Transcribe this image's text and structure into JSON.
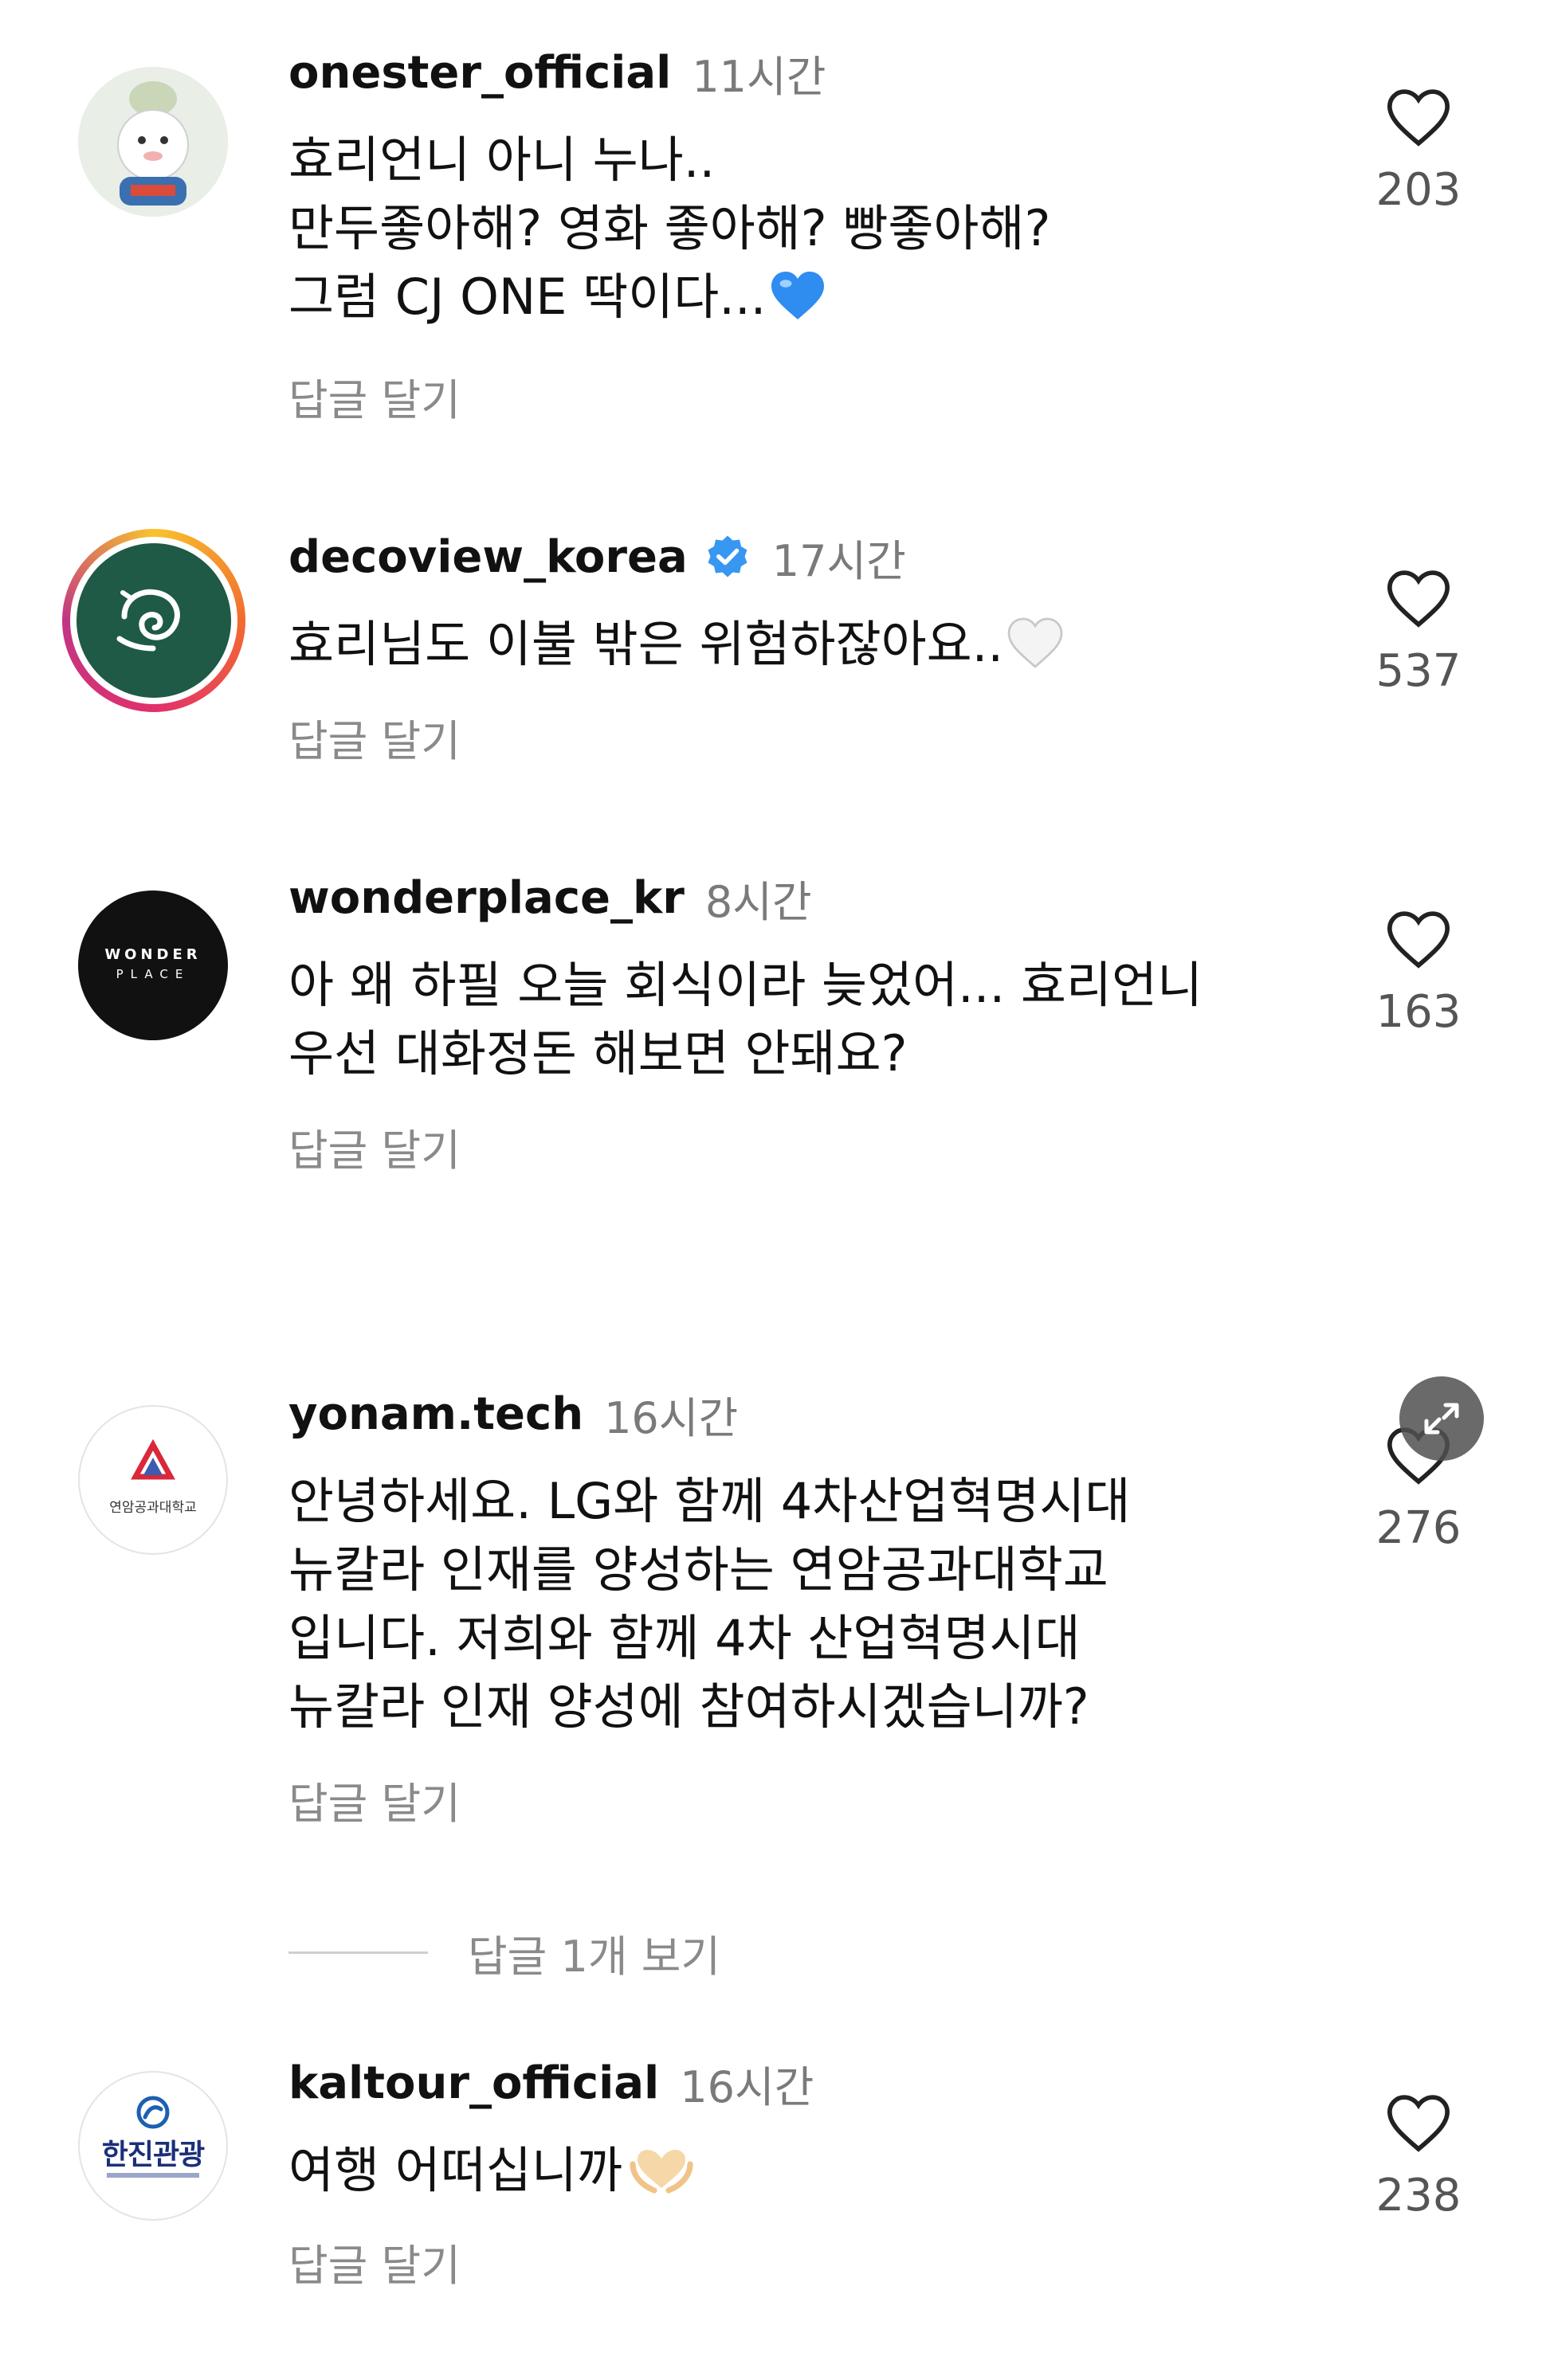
{
  "comments": [
    {
      "username": "onester_official",
      "time": "11시간",
      "lines": [
        "효리언니 아니 누나..",
        "만두좋아해? 영화 좋아해? 빵좋아해?",
        "그럼 CJ ONE 딱이다..."
      ],
      "emoji": "blue-heart-icon",
      "reply_label": "답글 달기",
      "likes": "203",
      "verified": false
    },
    {
      "username": "decoview_korea",
      "time": "17시간",
      "lines": [
        "효리님도 이불 밖은 위험하잖아요.."
      ],
      "emoji": "white-heart-icon",
      "reply_label": "답글 달기",
      "likes": "537",
      "verified": true
    },
    {
      "username": "wonderplace_kr",
      "time": "8시간",
      "lines": [
        "아 왜 하필 오늘 회식이라 늦었어... 효리언니",
        "우선 대화정돈 해보면 안돼요?"
      ],
      "reply_label": "답글 달기",
      "likes": "163",
      "verified": false
    },
    {
      "username": "yonam.tech",
      "time": "16시간",
      "lines": [
        "안녕하세요. LG와 함께 4차산업혁명시대",
        "뉴칼라 인재를 양성하는 연암공과대학교",
        "입니다. 저희와 함께 4차 산업혁명시대",
        "뉴칼라 인재 양성에 참여하시겠습니까?"
      ],
      "reply_label": "답글 달기",
      "likes": "276",
      "verified": false
    },
    {
      "username": "kaltour_official",
      "time": "16시간",
      "lines": [
        "여행 어떠십니까"
      ],
      "emoji": "heart-hands-icon",
      "reply_label": "답글 달기",
      "likes": "238",
      "verified": false
    }
  ],
  "view_replies_label": "답글 1개 보기",
  "avatars": {
    "wonderplace": [
      "WONDER",
      "PLACE"
    ],
    "yonam": "연암공과대학교",
    "kaltour": "한진관광"
  },
  "colors": {
    "verified_blue": "#3897f0",
    "decoview_green": "#1e5a46",
    "blue_heart": "#2f8cf0"
  }
}
